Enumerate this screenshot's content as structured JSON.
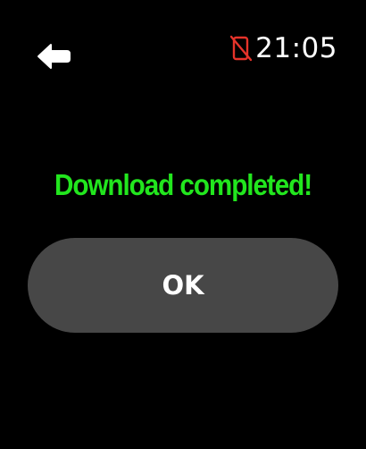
{
  "header": {
    "back_icon": "back-arrow-icon",
    "status_icon": "phone-disconnected-icon",
    "time": "21:05"
  },
  "dialog": {
    "message": "Download completed!",
    "ok_label": "OK"
  },
  "colors": {
    "background": "#000000",
    "message_text": "#22e61e",
    "button_fill": "#474747",
    "status_icon": "#e5332a",
    "text_primary": "#ffffff"
  }
}
